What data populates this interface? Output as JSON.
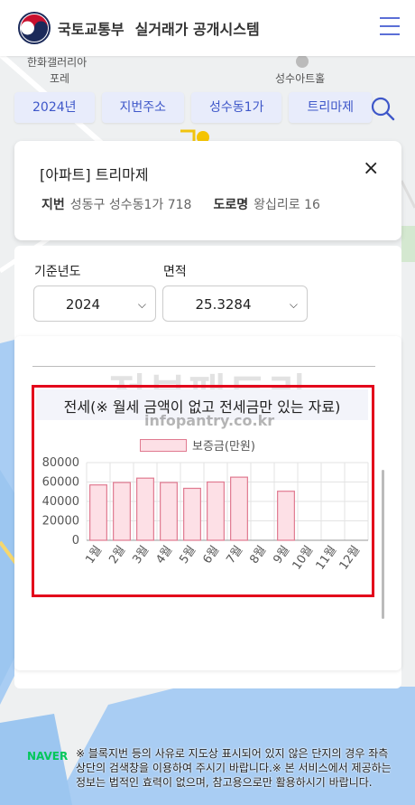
{
  "header": {
    "ministry": "국토교통부",
    "system_title": "실거래가 공개시스템"
  },
  "filters": {
    "year": "2024년",
    "address_type": "지번주소",
    "dong": "성수동1가",
    "complex": "트리마제"
  },
  "info": {
    "title": "[아파트] 트리마제",
    "lot_label": "지번",
    "lot_value": "성동구 성수동1가 718",
    "road_label": "도로명",
    "road_value": "왕십리로 16",
    "close_symbol": "×"
  },
  "selectors": {
    "year_label": "기준년도",
    "year_value": "2024",
    "area_label": "면적",
    "area_value": "25.3284"
  },
  "map_labels": {
    "hanwha": "한화갤러리아",
    "fore": "포레",
    "seongsu_art": "성수아트홀",
    "naver": "NAVER"
  },
  "watermark": {
    "main": "전부팬트리",
    "sub": "infopantry.co.kr"
  },
  "chart_data": {
    "type": "bar",
    "title": "전세(※ 월세 금액이 없고 전세금만 있는 자료)",
    "categories": [
      "1월",
      "2월",
      "3월",
      "4월",
      "5월",
      "6월",
      "7월",
      "8월",
      "9월",
      "10월",
      "11월",
      "12월"
    ],
    "series": [
      {
        "name": "보증금(만원)",
        "values": [
          57000,
          59500,
          64000,
          59500,
          53500,
          60000,
          65000,
          null,
          50500,
          null,
          null,
          null
        ]
      }
    ],
    "ylim": [
      0,
      80000
    ],
    "yticks": [
      0,
      20000,
      40000,
      60000,
      80000
    ],
    "grid": true,
    "legend": "top",
    "colors": {
      "bar_fill": "#fde0e6",
      "bar_stroke": "#e07a90"
    }
  },
  "footer": {
    "note": "※ 블록지번 등의 사유로 지도상 표시되어 있지 않은 단지의 경우 좌측 상단의 검색창을 이용하여 주시기 바랍니다.※ 본 서비스에서 제공하는 정보는 법적인 효력이 없으며, 참고용으로만 활용하시기 바랍니다."
  }
}
